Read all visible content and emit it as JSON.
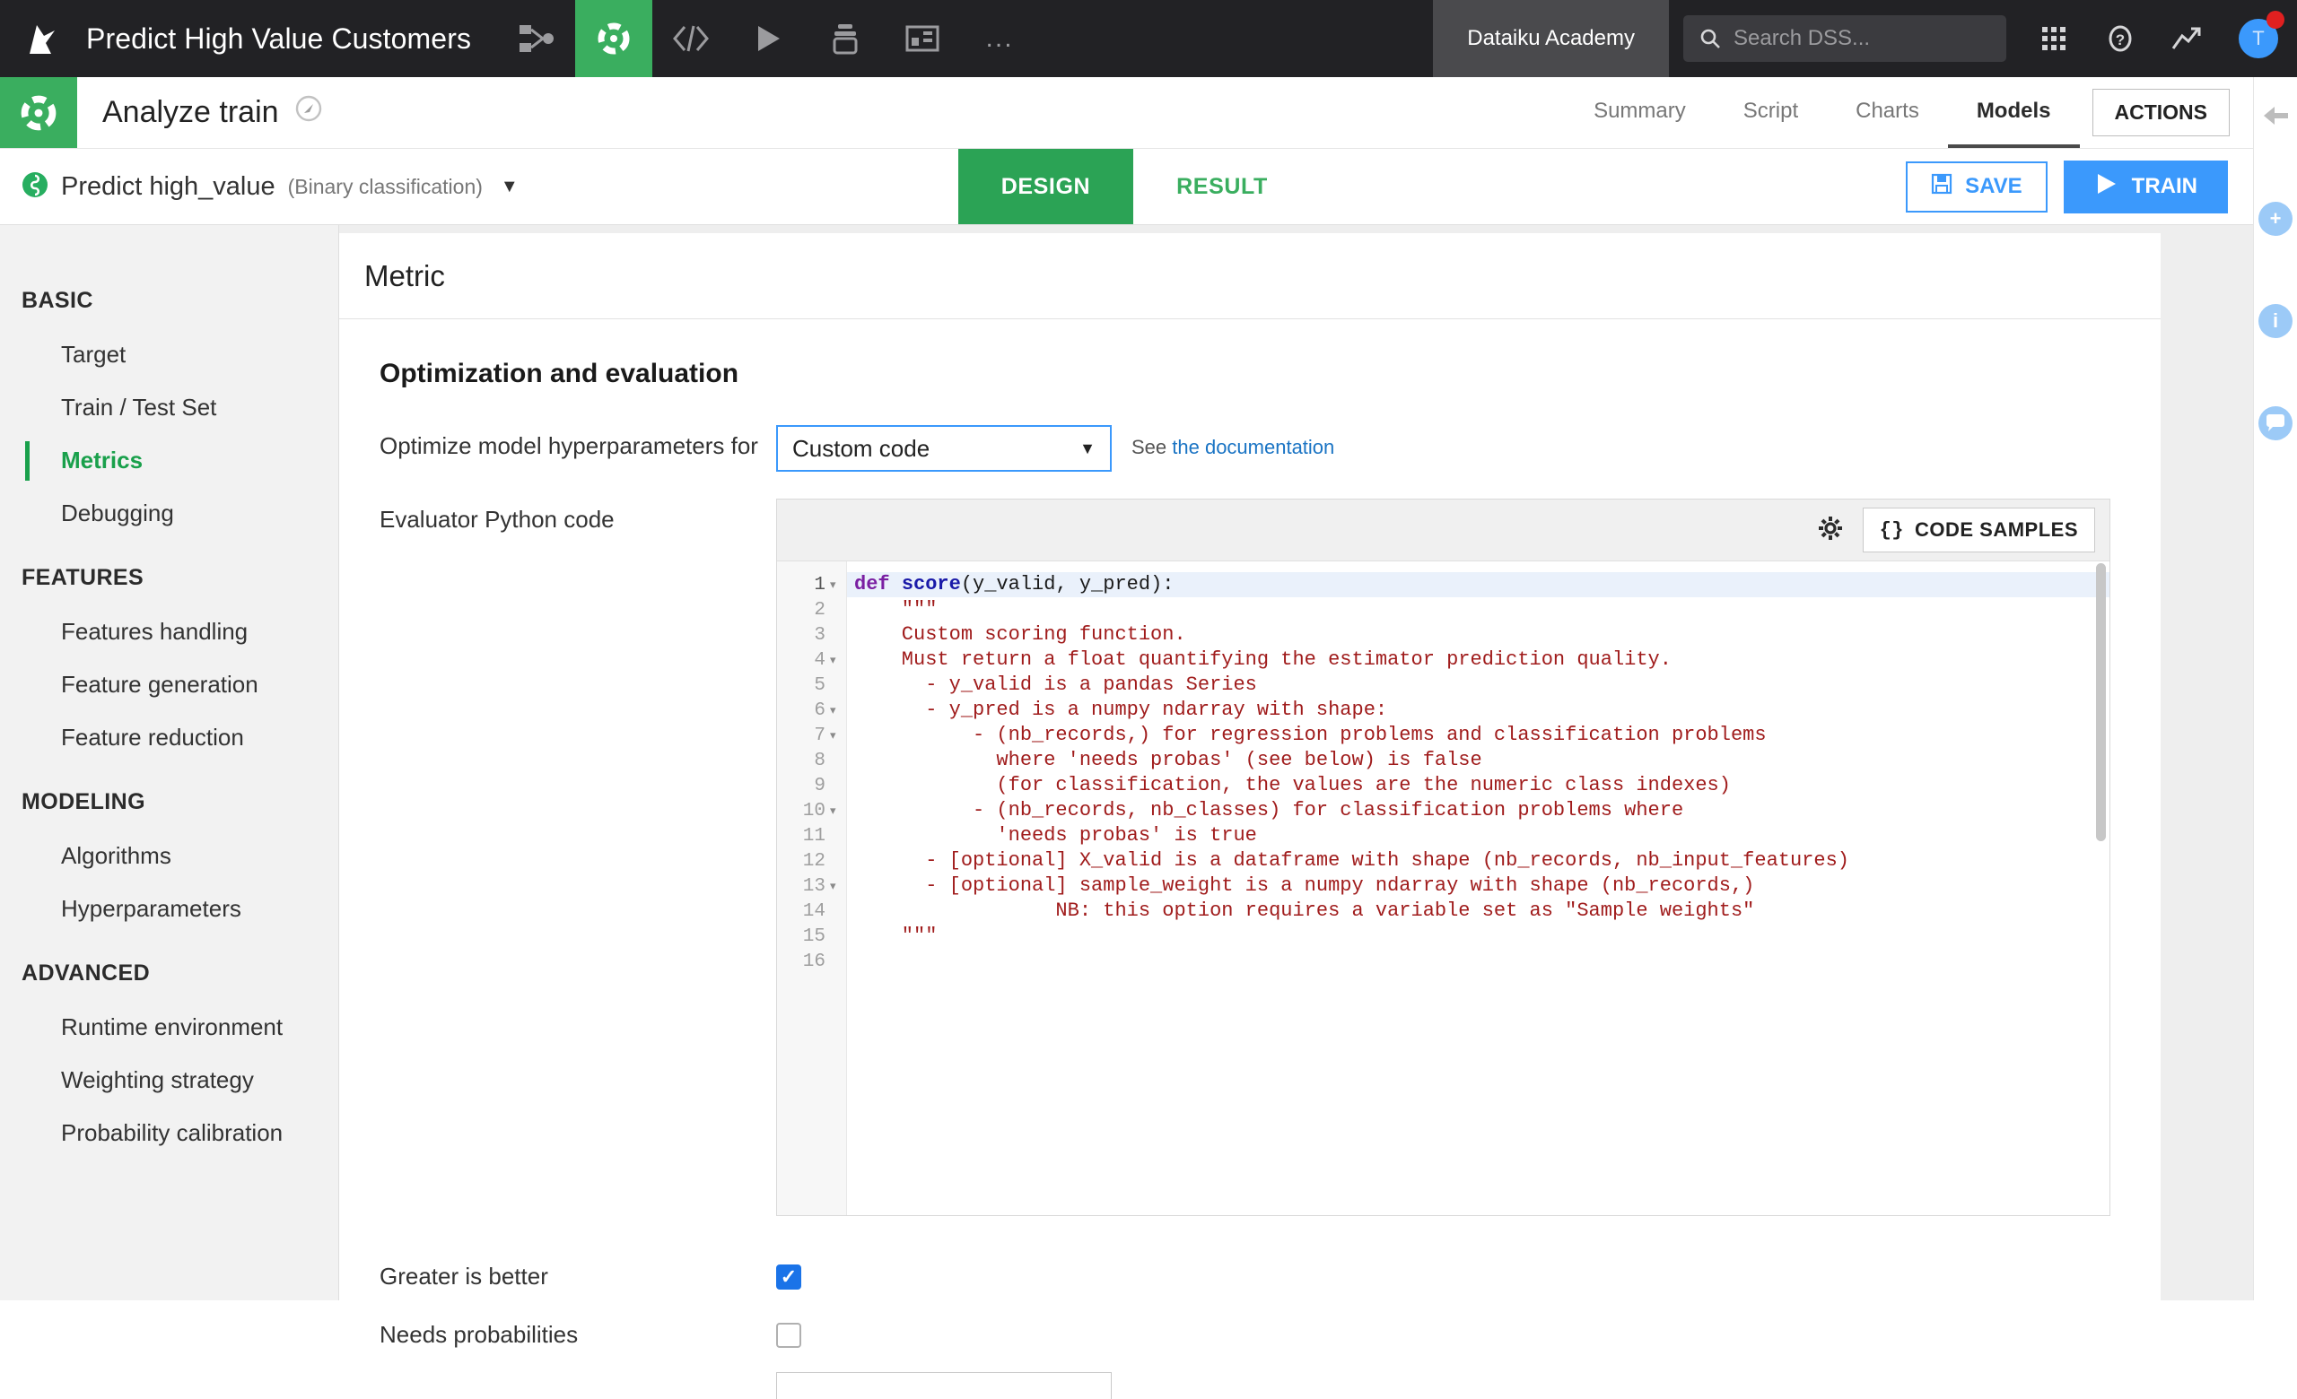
{
  "topbar": {
    "logo_icon": "dataiku-bird-logo",
    "project_title": "Predict High Value Customers",
    "icons": [
      {
        "name": "flow-icon",
        "glyph": "flow"
      },
      {
        "name": "lab-icon",
        "glyph": "lab",
        "active": true
      },
      {
        "name": "code-icon",
        "glyph": "</>"
      },
      {
        "name": "jobs-icon",
        "glyph": "play"
      },
      {
        "name": "automation-icon",
        "glyph": "stack"
      },
      {
        "name": "dashboard-icon",
        "glyph": "panel"
      },
      {
        "name": "more-icon",
        "glyph": "..."
      }
    ],
    "academy_label": "Dataiku Academy",
    "search": {
      "placeholder": "Search DSS...",
      "value": "",
      "icon": "search-icon"
    },
    "apps_icon": "apps-grid-icon",
    "help_icon": "help-circle-icon",
    "activity_icon": "trend-arrow-icon",
    "avatar_initial": "T",
    "notification_color": "#e02020"
  },
  "header": {
    "lab_icon": "lab-circle-icon",
    "title": "Analyze train",
    "compass_icon": "compass-icon",
    "tabs": [
      {
        "label": "Summary",
        "active": false
      },
      {
        "label": "Script",
        "active": false
      },
      {
        "label": "Charts",
        "active": false
      },
      {
        "label": "Models",
        "active": true
      }
    ],
    "actions_label": "ACTIONS"
  },
  "modelbar": {
    "python_icon": "python-recipe-icon",
    "model_name": "Predict high_value",
    "model_type": "(Binary classification)",
    "caret_icon": "chevron-down-icon",
    "tabs": [
      {
        "label": "DESIGN",
        "active": true
      },
      {
        "label": "RESULT",
        "active": false
      }
    ],
    "save_label": "SAVE",
    "save_icon": "floppy-disk-icon",
    "train_label": "TRAIN",
    "train_icon": "play-triangle-icon"
  },
  "rightrail": {
    "items": [
      {
        "name": "collapse-left-arrow-icon",
        "glyph": "←",
        "style": "plain"
      },
      {
        "name": "add-plus-icon",
        "glyph": "+",
        "style": "circle"
      },
      {
        "name": "info-icon",
        "glyph": "i",
        "style": "circle"
      },
      {
        "name": "discussions-icon",
        "glyph": "💬",
        "style": "circle"
      }
    ]
  },
  "sidebar": {
    "groups": [
      {
        "label": "BASIC",
        "items": [
          {
            "label": "Target",
            "active": false
          },
          {
            "label": "Train / Test Set",
            "active": false
          },
          {
            "label": "Metrics",
            "active": true
          },
          {
            "label": "Debugging",
            "active": false
          }
        ]
      },
      {
        "label": "FEATURES",
        "items": [
          {
            "label": "Features handling",
            "active": false
          },
          {
            "label": "Feature generation",
            "active": false
          },
          {
            "label": "Feature reduction",
            "active": false
          }
        ]
      },
      {
        "label": "MODELING",
        "items": [
          {
            "label": "Algorithms",
            "active": false
          },
          {
            "label": "Hyperparameters",
            "active": false
          }
        ]
      },
      {
        "label": "ADVANCED",
        "items": [
          {
            "label": "Runtime environment",
            "active": false
          },
          {
            "label": "Weighting strategy",
            "active": false
          },
          {
            "label": "Probability calibration",
            "active": false
          }
        ]
      }
    ]
  },
  "main": {
    "card_title": "Metric",
    "section_title": "Optimization and evaluation",
    "optimize_label": "Optimize model hyperparameters for",
    "optimize_value": "Custom code",
    "optimize_caret": "chevron-down-icon",
    "doc_prefix": "See ",
    "doc_link_text": "the documentation",
    "evaluator_label": "Evaluator Python code",
    "editor": {
      "gear_icon": "gear-icon",
      "code_samples_label": "CODE SAMPLES",
      "code_samples_icon": "curly-braces-icon",
      "total_lines": 16,
      "fold_lines": [
        1,
        4,
        6,
        7,
        10,
        13
      ],
      "highlighted_line": 1,
      "lines": [
        "def score(y_valid, y_pred):",
        "    \"\"\"",
        "    Custom scoring function.",
        "    Must return a float quantifying the estimator prediction quality.",
        "      - y_valid is a pandas Series",
        "      - y_pred is a numpy ndarray with shape:",
        "          - (nb_records,) for regression problems and classification problems",
        "            where 'needs probas' (see below) is false",
        "            (for classification, the values are the numeric class indexes)",
        "          - (nb_records, nb_classes) for classification problems where",
        "            'needs probas' is true",
        "      - [optional] X_valid is a dataframe with shape (nb_records, nb_input_features)",
        "      - [optional] sample_weight is a numpy ndarray with shape (nb_records,)",
        "                 NB: this option requires a variable set as \"Sample weights\"",
        "    \"\"\"",
        ""
      ]
    },
    "greater_is_better_label": "Greater is better",
    "greater_is_better_checked": true,
    "needs_probabilities_label": "Needs probabilities",
    "needs_probabilities_checked": false
  },
  "colors": {
    "green": "#3aae5f",
    "green_dark": "#2ba355",
    "blue": "#3b99fc",
    "dark": "#222225",
    "code_string": "#a01c1c",
    "code_keyword": "#7a1fa2",
    "code_function": "#1a1aa8"
  }
}
